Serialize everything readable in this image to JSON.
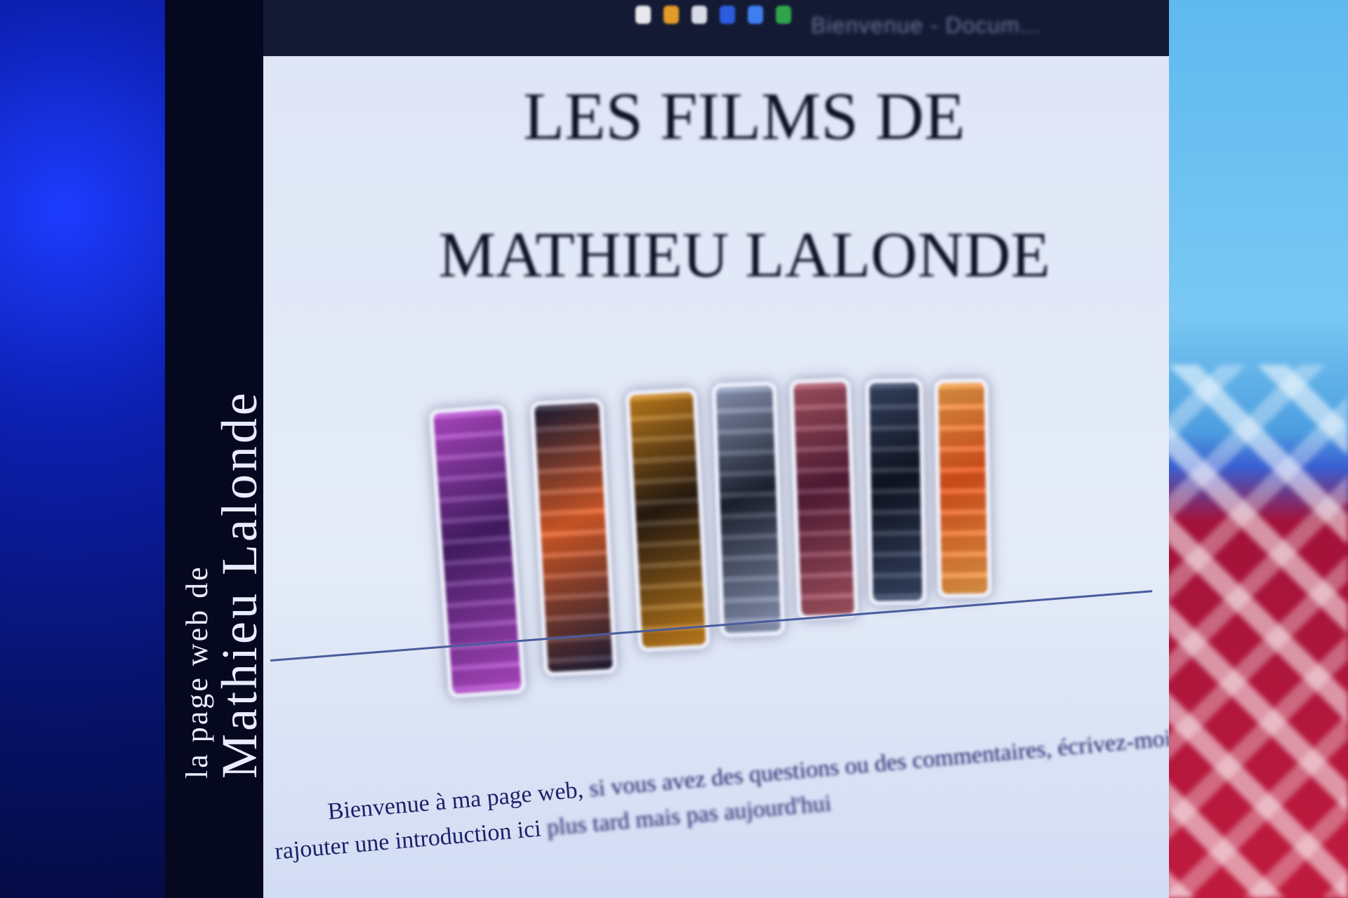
{
  "sidebar": {
    "subtitle": "la page web de",
    "name": "Mathieu Lalonde"
  },
  "page": {
    "title_line1": "LES FILMS DE",
    "title_line2": "MATHIEU LALONDE",
    "intro_line1_start": "Bienvenue à ma page web,",
    "intro_line1_rest": "si vous avez des questions ou des commentaires, écrivez-moi",
    "intro_line2_start": "rajouter une introduction ici",
    "intro_line2_rest": "plus tard mais pas aujourd'hui"
  },
  "browser": {
    "toolbar_text": "Bienvenue - Docum..."
  },
  "covers": [
    {
      "name": "dvd-cover-1",
      "color": "#4b1f6e",
      "accent": "#c04fd8"
    },
    {
      "name": "dvd-cover-2",
      "color": "#e7612a",
      "accent": "#1e1e3a"
    },
    {
      "name": "dvd-cover-3",
      "color": "#2a1c12",
      "accent": "#d48a1e"
    },
    {
      "name": "dvd-cover-4",
      "color": "#1f2535",
      "accent": "#9aa6c8"
    },
    {
      "name": "dvd-cover-5",
      "color": "#5a1e3a",
      "accent": "#b25a6a"
    },
    {
      "name": "dvd-cover-6",
      "color": "#111626",
      "accent": "#3b4a6b"
    },
    {
      "name": "dvd-cover-7",
      "color": "#e9561e",
      "accent": "#f4a24a"
    }
  ],
  "colors": {
    "page_bg": "#e4ebf8",
    "title": "#0e1025",
    "intro_text": "#1c2068",
    "sidebar_bg": "#05081e"
  }
}
